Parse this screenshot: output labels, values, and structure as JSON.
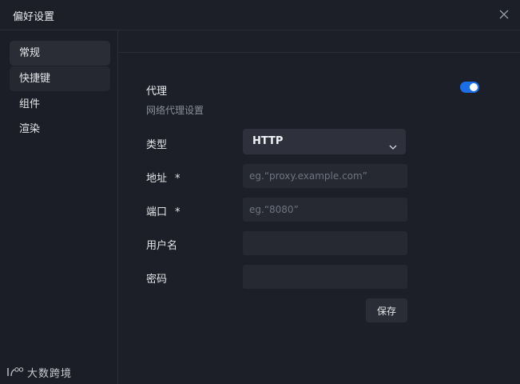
{
  "window": {
    "title": "偏好设置"
  },
  "sidebar": {
    "items": [
      {
        "label": "常规",
        "state": "active"
      },
      {
        "label": "快捷键",
        "state": "hover"
      },
      {
        "label": "组件",
        "state": "normal"
      },
      {
        "label": "渲染",
        "state": "normal"
      }
    ]
  },
  "brand": {
    "text": "大数跨境"
  },
  "proxy": {
    "title": "代理",
    "subtitle": "网络代理设置",
    "enabled": true,
    "toggle_color": "#1a6fe8",
    "type_label": "类型",
    "type_value": "HTTP",
    "address_label": "地址",
    "address_placeholder": "eg.“proxy.example.com”",
    "address_value": "",
    "port_label": "端口",
    "port_placeholder": "eg.“8080”",
    "port_value": "",
    "username_label": "用户名",
    "username_value": "",
    "password_label": "密码",
    "password_value": "",
    "required_mark": "*",
    "save_label": "保存"
  }
}
